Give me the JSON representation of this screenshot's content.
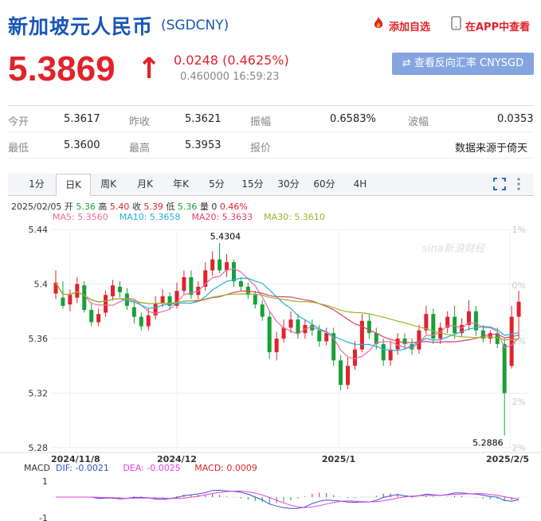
{
  "header": {
    "title": "新加坡元人民币",
    "code": "(SGDCNY)",
    "add_fav": "添加自选",
    "view_app": "在APP中查看"
  },
  "quote": {
    "price": "5.3869",
    "arrow": "↑",
    "change": "0.0248 (0.4625%)",
    "time": "0.460000 16:59:23",
    "reverse_btn": "⇄ 查看反向汇率 CNYSGD"
  },
  "stats": {
    "open_label": "今开",
    "open": "5.3617",
    "prev_label": "昨收",
    "prev": "5.3621",
    "amp_label": "振幅",
    "amp": "0.6583%",
    "wave_label": "波幅",
    "wave": "0.0353",
    "low_label": "最低",
    "low": "5.3600",
    "high_label": "最高",
    "high": "5.3953",
    "quote_label": "报价",
    "source": "数据来源于倚天"
  },
  "tabs": [
    "1分",
    "日K",
    "周K",
    "月K",
    "年K",
    "5分",
    "15分",
    "30分",
    "60分",
    "4H"
  ],
  "icons": {
    "fullscreen": "fullscreen-icon",
    "more": "more-icon",
    "fire": "fire-icon",
    "phone": "phone-icon",
    "exchange": "exchange-icon"
  },
  "info": {
    "date": "2025/02/05",
    "open_l": "开",
    "open_v": "5.36",
    "high_l": "高",
    "high_v": "5.40",
    "close_l": "收",
    "close_v": "5.39",
    "low_l": "低",
    "low_v": "5.36",
    "vol_l": "量",
    "vol_v": "0",
    "pct": "0.46%"
  },
  "ma": {
    "ma5": "MA5: 5.3560",
    "ma10": "MA10: 5.3658",
    "ma20": "MA20: 5.3633",
    "ma30": "MA30: 5.3610"
  },
  "macd": {
    "label": "MACD",
    "dif": "DIF: -0.0021",
    "dea": "DEA: -0.0025",
    "macd": "MACD: 0.0009"
  },
  "colors": {
    "up": "#e0232b",
    "down": "#18a038",
    "brand": "#1a56b8",
    "ma5": "#f06aa0",
    "ma10": "#22b0d8",
    "ma20": "#e0406a",
    "ma30": "#9ab52a",
    "dif": "#3355cc",
    "dea": "#e040e0"
  },
  "chart_data": {
    "type": "candlestick",
    "y_ticks": [
      "5.44",
      "5.4",
      "5.36",
      "5.32",
      "5.28"
    ],
    "y_range": [
      5.28,
      5.44
    ],
    "pct_ticks": [
      "1%",
      "0%",
      "1%",
      "2%",
      "2%"
    ],
    "x_labels": [
      "2024/11/8",
      "2024/12",
      "2025/1",
      "2025/2/5"
    ],
    "max_label": "5.4304",
    "min_label": "5.2886",
    "watermark": "sina新浪财经",
    "macd_ticks": [
      "1",
      "-1"
    ],
    "candles": [
      [
        5.393,
        5.401,
        5.41,
        5.389
      ],
      [
        5.39,
        5.384,
        5.402,
        5.382
      ],
      [
        5.385,
        5.392,
        5.396,
        5.38
      ],
      [
        5.39,
        5.4,
        5.405,
        5.386
      ],
      [
        5.399,
        5.381,
        5.402,
        5.379
      ],
      [
        5.381,
        5.372,
        5.386,
        5.369
      ],
      [
        5.372,
        5.378,
        5.382,
        5.369
      ],
      [
        5.379,
        5.392,
        5.395,
        5.376
      ],
      [
        5.391,
        5.399,
        5.403,
        5.388
      ],
      [
        5.398,
        5.394,
        5.402,
        5.39
      ],
      [
        5.393,
        5.384,
        5.397,
        5.381
      ],
      [
        5.383,
        5.376,
        5.388,
        5.371
      ],
      [
        5.376,
        5.369,
        5.379,
        5.366
      ],
      [
        5.369,
        5.377,
        5.382,
        5.366
      ],
      [
        5.377,
        5.386,
        5.391,
        5.374
      ],
      [
        5.386,
        5.391,
        5.396,
        5.383
      ],
      [
        5.391,
        5.384,
        5.394,
        5.381
      ],
      [
        5.384,
        5.395,
        5.401,
        5.382
      ],
      [
        5.395,
        5.405,
        5.41,
        5.392
      ],
      [
        5.405,
        5.392,
        5.41,
        5.389
      ],
      [
        5.392,
        5.398,
        5.402,
        5.389
      ],
      [
        5.398,
        5.41,
        5.416,
        5.395
      ],
      [
        5.41,
        5.418,
        5.424,
        5.406
      ],
      [
        5.418,
        5.41,
        5.43,
        5.408
      ],
      [
        5.41,
        5.416,
        5.422,
        5.405
      ],
      [
        5.416,
        5.402,
        5.418,
        5.398
      ],
      [
        5.402,
        5.398,
        5.405,
        5.395
      ],
      [
        5.398,
        5.392,
        5.401,
        5.389
      ],
      [
        5.392,
        5.385,
        5.395,
        5.382
      ],
      [
        5.385,
        5.376,
        5.388,
        5.373
      ],
      [
        5.376,
        5.35,
        5.38,
        5.345
      ],
      [
        5.35,
        5.36,
        5.365,
        5.344
      ],
      [
        5.36,
        5.368,
        5.374,
        5.357
      ],
      [
        5.368,
        5.374,
        5.38,
        5.364
      ],
      [
        5.374,
        5.364,
        5.378,
        5.36
      ],
      [
        5.364,
        5.37,
        5.374,
        5.36
      ],
      [
        5.37,
        5.366,
        5.374,
        5.362
      ],
      [
        5.366,
        5.358,
        5.37,
        5.354
      ],
      [
        5.358,
        5.364,
        5.368,
        5.355
      ],
      [
        5.364,
        5.344,
        5.368,
        5.34
      ],
      [
        5.344,
        5.326,
        5.348,
        5.322
      ],
      [
        5.326,
        5.34,
        5.346,
        5.323
      ],
      [
        5.34,
        5.352,
        5.358,
        5.337
      ],
      [
        5.352,
        5.373,
        5.378,
        5.35
      ],
      [
        5.373,
        5.364,
        5.378,
        5.36
      ],
      [
        5.364,
        5.356,
        5.368,
        5.352
      ],
      [
        5.356,
        5.344,
        5.36,
        5.34
      ],
      [
        5.344,
        5.352,
        5.358,
        5.34
      ],
      [
        5.352,
        5.36,
        5.364,
        5.348
      ],
      [
        5.36,
        5.356,
        5.364,
        5.352
      ],
      [
        5.356,
        5.352,
        5.36,
        5.348
      ],
      [
        5.352,
        5.366,
        5.37,
        5.349
      ],
      [
        5.366,
        5.378,
        5.384,
        5.363
      ],
      [
        5.378,
        5.36,
        5.382,
        5.356
      ],
      [
        5.36,
        5.368,
        5.372,
        5.356
      ],
      [
        5.368,
        5.376,
        5.38,
        5.364
      ],
      [
        5.376,
        5.364,
        5.384,
        5.36
      ],
      [
        5.364,
        5.37,
        5.375,
        5.361
      ],
      [
        5.37,
        5.38,
        5.388,
        5.366
      ],
      [
        5.38,
        5.366,
        5.384,
        5.362
      ],
      [
        5.366,
        5.36,
        5.37,
        5.357
      ],
      [
        5.36,
        5.364,
        5.366,
        5.356
      ],
      [
        5.364,
        5.356,
        5.368,
        5.353
      ],
      [
        5.356,
        5.32,
        5.36,
        5.289
      ],
      [
        5.34,
        5.376,
        5.384,
        5.338
      ],
      [
        5.376,
        5.387,
        5.395,
        5.36
      ]
    ]
  }
}
